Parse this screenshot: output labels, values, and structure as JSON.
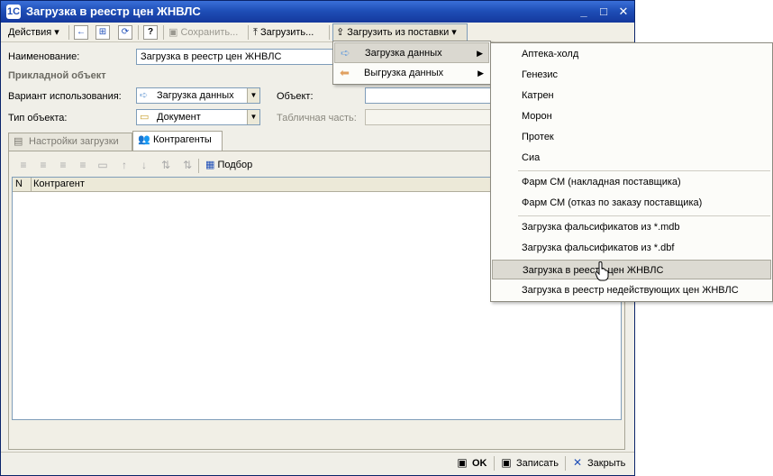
{
  "window": {
    "title": "Загрузка в реестр цен ЖНВЛС"
  },
  "toolbar": {
    "actions_label": "Действия",
    "save_label": "Сохранить...",
    "load_label": "Загрузить...",
    "load_from_delivery_label": "Загрузить из поставки"
  },
  "form": {
    "name_label": "Наименование:",
    "name_value": "Загрузка в реестр цен ЖНВЛС",
    "section_label": "Прикладной объект",
    "usage_label": "Вариант использования:",
    "usage_value": "Загрузка данных",
    "object_label": "Объект:",
    "object_type_label": "Тип объекта:",
    "object_type_value": "Документ",
    "table_part_label": "Табличная часть:"
  },
  "tabs": [
    {
      "label": "Настройки загрузки"
    },
    {
      "label": "Контрагенты"
    }
  ],
  "panel": {
    "pick_label": "Подбор",
    "columns": [
      "N",
      "Контрагент"
    ]
  },
  "bottom": {
    "ok_label": "OK",
    "write_label": "Записать",
    "close_label": "Закрыть"
  },
  "menu": {
    "items": [
      {
        "label": "Загрузка данных",
        "icon": "arrow-right-icon"
      },
      {
        "label": "Выгрузка данных",
        "icon": "arrow-left-icon"
      }
    ]
  },
  "submenu": {
    "items": [
      "Аптека-холд",
      "Генезис",
      "Катрен",
      "Морон",
      "Протек",
      "Сиа",
      "Фарм СМ (накладная поставщика)",
      "Фарм СМ (отказ по заказу поставщика)",
      "Загрузка фальсификатов из *.mdb",
      "Загрузка фальсификатов из *.dbf",
      "Загрузка в реестр цен ЖНВЛС",
      "Загрузка в реестр недействующих цен ЖНВЛС"
    ],
    "hovered": "Загрузка в реестр цен ЖНВЛС"
  },
  "colors": {
    "titlebar": "#1f4fb8",
    "menu_highlight": "#dad8d0",
    "window_bg": "#f0efe8"
  }
}
